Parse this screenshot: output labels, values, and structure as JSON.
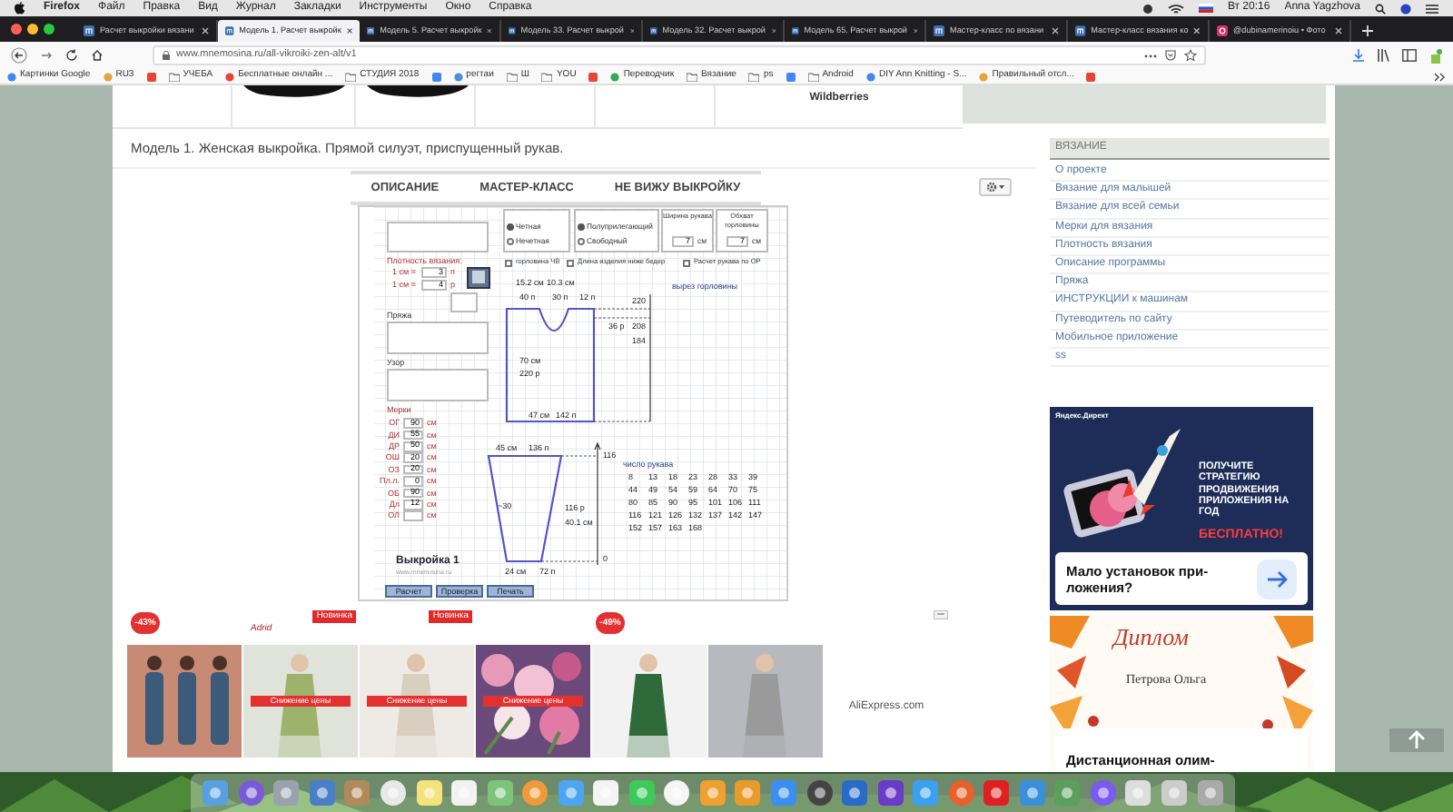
{
  "menu_bar": {
    "app": "Firefox",
    "items": [
      "Файл",
      "Правка",
      "Вид",
      "Журнал",
      "Закладки",
      "Инструменты",
      "Окно",
      "Справка"
    ],
    "clock": "Вт 20:16",
    "user": "Anna Yagzhova"
  },
  "tabs": [
    {
      "title": "Расчет выкройки вязани",
      "kind": "site",
      "selected": false
    },
    {
      "title": "Модель 1. Расчет выкройк",
      "kind": "site",
      "selected": true
    },
    {
      "title": "Модель 5. Расчет выкройк",
      "kind": "site",
      "selected": false
    },
    {
      "title": "Модель 33. Расчет выкрой",
      "kind": "site",
      "selected": false
    },
    {
      "title": "Модель 32. Расчет выкрой",
      "kind": "site",
      "selected": false
    },
    {
      "title": "Модель 65. Расчет выкрой",
      "kind": "site",
      "selected": false
    },
    {
      "title": "Мастер-класс по вязани",
      "kind": "site",
      "selected": false
    },
    {
      "title": "Мастер-класс вязания ко",
      "kind": "site",
      "selected": false
    },
    {
      "title": "@dubinamerinoiu • Фото",
      "selected": false
    }
  ],
  "url": "www.mnemosina.ru/all-vikroiki-zen-alt/v1",
  "bookmarks": [
    {
      "label": "Картинки Google",
      "kind": "link"
    },
    {
      "label": "RU3",
      "kind": "link"
    },
    {
      "label": "УЧЕБА",
      "kind": "folder"
    },
    {
      "label": "Бесплатные онлайн ...",
      "kind": "link"
    },
    {
      "label": "СТУДИЯ 2018",
      "kind": "folder"
    },
    {
      "label": "регтаи",
      "kind": "link"
    },
    {
      "label": "Ш",
      "kind": "folder"
    },
    {
      "label": "YOU",
      "kind": "folder"
    },
    {
      "label": "Переводчик",
      "kind": "link"
    },
    {
      "label": "Вязание",
      "kind": "folder"
    },
    {
      "label": "ps",
      "kind": "folder"
    },
    {
      "label": "Android",
      "kind": "folder"
    },
    {
      "label": "DIY Ann Knitting - S...",
      "kind": "link"
    },
    {
      "label": "Правильный отсл...",
      "kind": "link"
    }
  ],
  "top_strip": {
    "store": "Wildberries"
  },
  "heading": "Модель 1. Женская выкройка. Прямой силуэт, приспущенный рукав.",
  "app_tabs": [
    "ОПИСАНИЕ",
    "МАСТЕР-КЛАСС",
    "НЕ ВИЖУ ВЫКРОЙКУ"
  ],
  "calculator": {
    "density_title": "Плотность вязания:",
    "density": [
      {
        "unit": "1 см =",
        "value": "3",
        "suffix": "п"
      },
      {
        "unit": "1 см =",
        "value": "4",
        "suffix": "р"
      }
    ],
    "yarn_label": "Пряжа",
    "pattern_label": "Узор",
    "options": [
      {
        "choices": [
          {
            "label": "Четная",
            "selected": true
          },
          {
            "label": "Нечетная",
            "selected": false
          }
        ]
      },
      {
        "choices": [
          {
            "label": "Полуприлегающий",
            "selected": true
          },
          {
            "label": "Свободный",
            "selected": false
          }
        ]
      }
    ],
    "extras": [
      {
        "title": "Ширина рукава",
        "value": "7",
        "unit": "см"
      },
      {
        "title": "Обхват горловины",
        "value": "7",
        "unit": "см"
      }
    ],
    "checkboxes": [
      {
        "label": "горловина ЧВ",
        "checked": false
      },
      {
        "label": "Длина изделия ниже бедер",
        "checked": false
      },
      {
        "label": "Расчет рукава по ОР",
        "checked": false
      }
    ],
    "measures_title": "Мерки",
    "measures": [
      {
        "label": "ОГ",
        "value": "90",
        "unit": "см"
      },
      {
        "label": "ДИ",
        "value": "55",
        "unit": "см"
      },
      {
        "label": "ДР",
        "value": "50",
        "unit": "см"
      },
      {
        "label": "ОШ",
        "value": "20",
        "unit": "см"
      },
      {
        "label": "ОЗ",
        "value": "20",
        "unit": "см"
      },
      {
        "label": "Пл.л.",
        "value": "0",
        "unit": "см"
      },
      {
        "label": "ОБ",
        "value": "90",
        "unit": "см"
      },
      {
        "label": "Дл",
        "value": "12",
        "unit": "см"
      },
      {
        "label": "ОЛ",
        "unit": "см"
      }
    ],
    "pattern_name": "Выкройка 1",
    "site": "www.mnemosina.ru",
    "buttons": [
      "Расчет",
      "Проверка",
      "Печать"
    ],
    "diagram_labels": [
      "15.2 см",
      "10.3 см",
      "40 п",
      "30 п",
      "12 п",
      "220",
      "36 р",
      "208",
      "184",
      "70 см",
      "220 р",
      "47 см",
      "142 п",
      "45 см",
      "136 п",
      "116",
      "~30",
      "116 р",
      "40.1 см",
      "0",
      "24 см",
      "72 п"
    ],
    "neckline_title": "вырез горловины",
    "sleeve_title": "число рукава",
    "sleeve_table": [
      [
        "8",
        "13",
        "18",
        "23",
        "28",
        "33",
        "39"
      ],
      [
        "44",
        "49",
        "54",
        "59",
        "64",
        "70",
        "75"
      ],
      [
        "80",
        "85",
        "90",
        "95",
        "101",
        "106",
        "111"
      ],
      [
        "116",
        "121",
        "126",
        "132",
        "137",
        "142",
        "147"
      ],
      [
        "152",
        "157",
        "163",
        "168"
      ]
    ]
  },
  "sidebar": {
    "title": "ВЯЗАНИЕ",
    "items": [
      "О проекте",
      "Вязание для малышей",
      "Вязание для всей семьи",
      "Мерки для вязания",
      "Плотность вязания",
      "Описание программы",
      "Пряжа",
      "ИНСТРУКЦИИ к машинам",
      "Путеводитель по сайту",
      "Мобильное приложение",
      "ss"
    ]
  },
  "ad": {
    "source": "Яндекс.Директ",
    "headline": "ПОЛУЧИТЕ СТРАТЕГИЮ ПРОДВИЖЕНИЯ ПРИЛОЖЕНИЯ НА ГОД",
    "highlight": "БЕСПЛАТНО!",
    "question": "Мало установок при-\nложения?"
  },
  "diploma": {
    "title": "Диплом",
    "name": "Петрова Ольга",
    "caption": "Дистанционная олим-"
  },
  "products": [
    {
      "kind": "picture",
      "badge": {
        "kind": "discount",
        "text": "-43%"
      }
    },
    {
      "kind": "picture",
      "badge": {
        "kind": "new",
        "text": "Новинка"
      },
      "brand": "Adrid",
      "ribbon": "Снижение цены"
    },
    {
      "kind": "picture",
      "badge": {
        "kind": "new",
        "text": "Новинка"
      },
      "ribbon": "Снижение цены"
    },
    {
      "kind": "picture",
      "ribbon": "Снижение цены"
    },
    {
      "kind": "picture",
      "badge": {
        "kind": "discount",
        "text": "-49%"
      }
    },
    {
      "kind": "picture"
    }
  ],
  "ad_source": "AliExpress.com"
}
